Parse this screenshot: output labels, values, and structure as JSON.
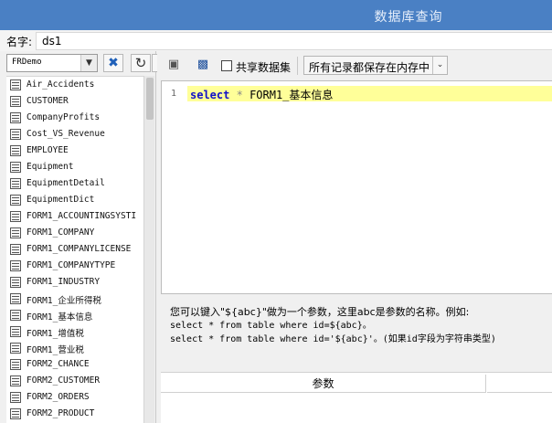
{
  "window": {
    "title": "数据库查询"
  },
  "name_bar": {
    "label": "名字:",
    "value": "ds1"
  },
  "left_panel": {
    "datasource": "FRDemo",
    "tables": [
      "Air_Accidents",
      "CUSTOMER",
      "CompanyProfits",
      "Cost_VS_Revenue",
      "EMPLOYEE",
      "Equipment",
      "EquipmentDetail",
      "EquipmentDict",
      "FORM1_ACCOUNTINGSYSTI",
      "FORM1_COMPANY",
      "FORM1_COMPANYLICENSE",
      "FORM1_COMPANYTYPE",
      "FORM1_INDUSTRY",
      "FORM1_企业所得税",
      "FORM1_基本信息",
      "FORM1_增值税",
      "FORM1_营业税",
      "FORM2_CHANCE",
      "FORM2_CUSTOMER",
      "FORM2_ORDERS",
      "FORM2_PRODUCT"
    ]
  },
  "toolbar": {
    "share_label": "共享数据集",
    "mode_value": "所有记录都保存在内存中"
  },
  "editor": {
    "line_number": "1",
    "keyword": "select",
    "star": "*",
    "table": "FORM1_基本信息"
  },
  "hint": {
    "line1": "您可以键入\"${abc}\"做为一个参数，这里abc是参数的名称。例如:",
    "line2": "select * from table where id=${abc}。",
    "line3": "select * from table where id='${abc}'。(如果id字段为字符串类型)"
  },
  "params": {
    "header": "参数"
  }
}
